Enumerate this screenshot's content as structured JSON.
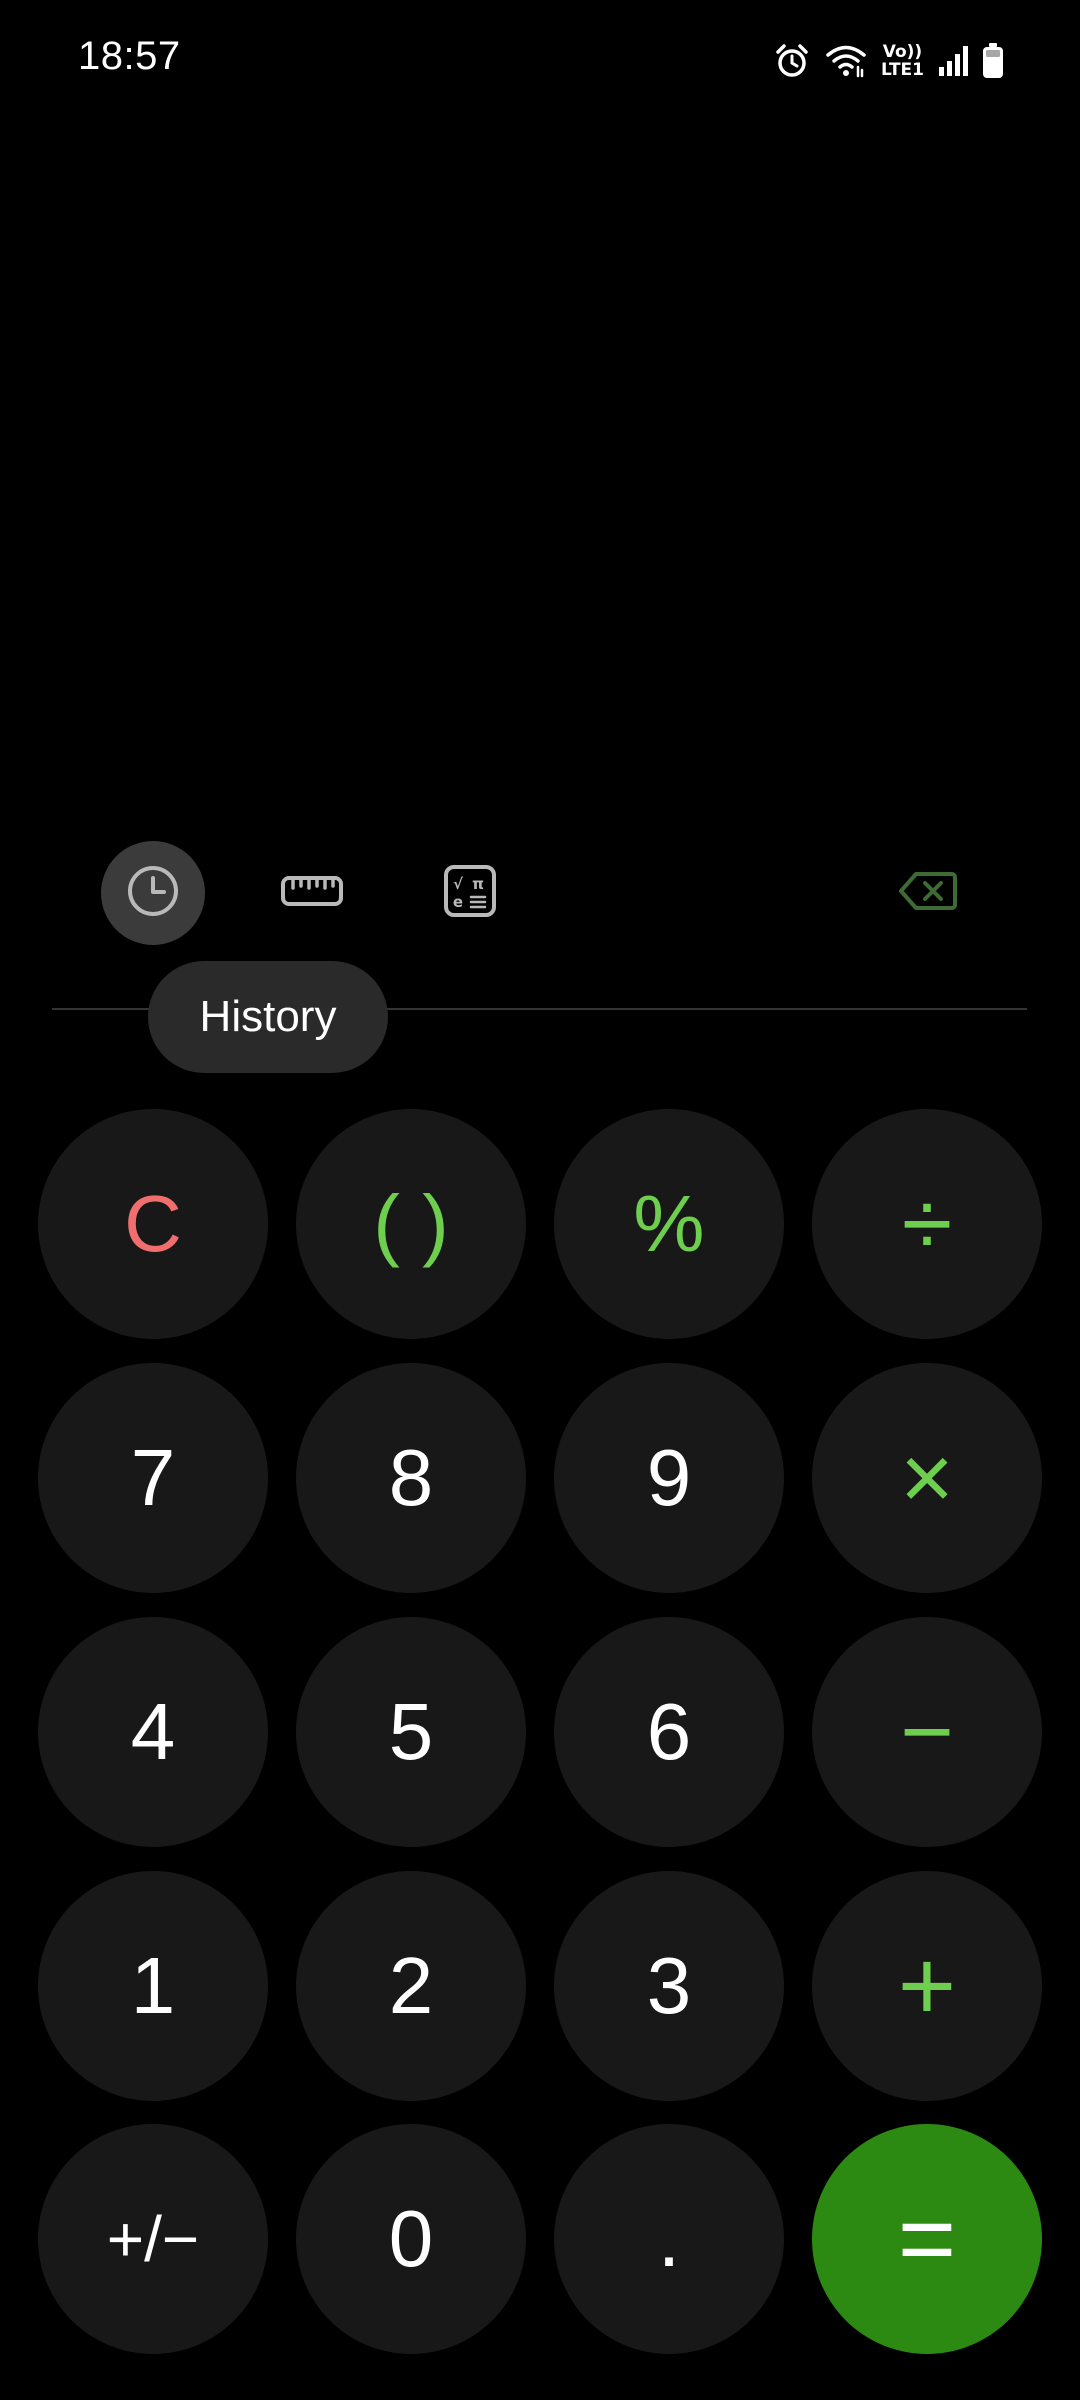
{
  "status_bar": {
    "time": "18:57",
    "icons": [
      "alarm-icon",
      "wifi-icon",
      "volte-icon",
      "signal-icon",
      "battery-icon"
    ],
    "volte_top": "Vo))",
    "volte_bottom": "LTE1"
  },
  "display": {
    "expression": "",
    "result": ""
  },
  "toolbar": {
    "history_icon": "clock-icon",
    "unit_converter_icon": "ruler-icon",
    "scientific_icon": "scientific-calc-icon",
    "backspace_icon": "backspace-icon",
    "tooltip": "History"
  },
  "keypad": {
    "rows": [
      [
        "C",
        "( )",
        "%",
        "÷"
      ],
      [
        "7",
        "8",
        "9",
        "×"
      ],
      [
        "4",
        "5",
        "6",
        "−"
      ],
      [
        "1",
        "2",
        "3",
        "+"
      ],
      [
        "+/−",
        "0",
        ".",
        "="
      ]
    ]
  },
  "colors": {
    "background": "#000000",
    "key_background": "#181818",
    "clear": "#f06e6e",
    "operator": "#6dcf4d",
    "equals_background": "#2c8a12",
    "backspace_disabled": "#3e6a33"
  }
}
